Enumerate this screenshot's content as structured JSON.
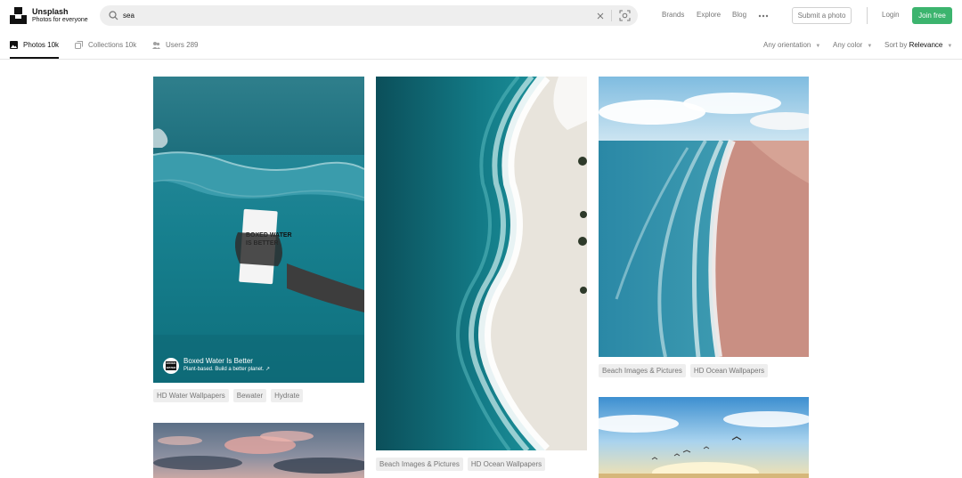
{
  "brand": {
    "name": "Unsplash",
    "tagline": "Photos for everyone"
  },
  "search": {
    "value": "sea",
    "placeholder": ""
  },
  "nav": {
    "brands": "Brands",
    "explore": "Explore",
    "blog": "Blog"
  },
  "actions": {
    "submit": "Submit a photo",
    "login": "Login",
    "join": "Join free"
  },
  "tabs": [
    {
      "label": "Photos 10k",
      "icon": "photo-icon"
    },
    {
      "label": "Collections 10k",
      "icon": "collections-icon"
    },
    {
      "label": "Users 289",
      "icon": "users-icon"
    }
  ],
  "filters": {
    "orientation": "Any orientation",
    "color": "Any color",
    "sort_prefix": "Sort by",
    "sort_value": "Relevance"
  },
  "photos": {
    "col1_top": {
      "tags": [
        "HD Water Wallpapers",
        "Bewater",
        "Hydrate"
      ],
      "ad_title": "Boxed Water Is Better",
      "ad_subtitle": "Plant-based. Build a better planet. ↗",
      "carton_text": "BOXED WATER IS BETTER",
      "avatar_text": "BOXED WATER"
    },
    "col2_top": {
      "tags": [
        "Beach Images & Pictures",
        "HD Ocean Wallpapers"
      ]
    },
    "col3_top": {
      "tags": [
        "Beach Images & Pictures",
        "HD Ocean Wallpapers"
      ]
    }
  },
  "colors": {
    "accent": "#3cb46e",
    "tag_bg": "#eeeeee",
    "muted": "#767676"
  }
}
